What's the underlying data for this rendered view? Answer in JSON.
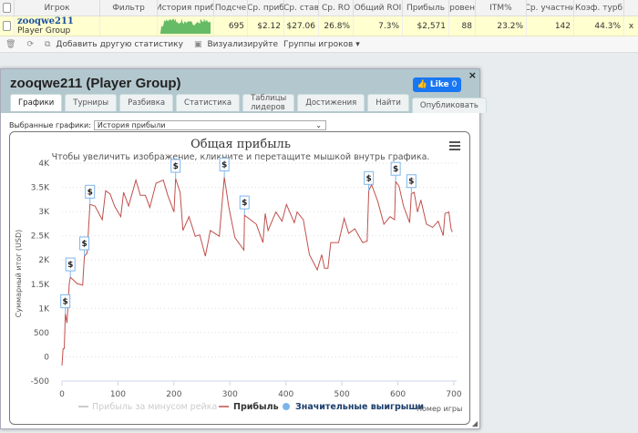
{
  "table": {
    "headers": [
      "Игрок",
      "Фильтр",
      "История приб",
      "Подсче",
      "Ср. приб",
      "Ср. став",
      "Ср. RO",
      "Общий ROI",
      "Прибыль",
      "Уровень",
      "ITM%",
      "Ср. участни",
      "Коэф. турб"
    ],
    "row": {
      "player": "zooqwe211",
      "group": "Player Group",
      "filter": "",
      "cells": [
        "695",
        "$2.12",
        "$27.06",
        "26.8%",
        "7.3%",
        "$2,571",
        "88",
        "23.2%",
        "142",
        "44.3%"
      ],
      "remove": "x"
    }
  },
  "toolbar": {
    "add_stat": "Добавить другую статистику",
    "visualize": "Визуализируйте",
    "player_groups": "Группы игроков"
  },
  "dialog": {
    "title": "zooqwe211 (Player Group)",
    "like_label": "Like",
    "like_count": "0",
    "close": "×",
    "tabs": [
      "Графики",
      "Турниры",
      "Разбивка",
      "Статистика",
      "Таблицы лидеров",
      "Достижения",
      "Найти",
      "Опубликовать"
    ],
    "selected_label": "Выбранные графики:",
    "selected_value": "История прибыли"
  },
  "colors": {
    "profit": "#c0504d",
    "big_win": "#7cb5ec",
    "sparkline": "#66bb66"
  },
  "chart_data": {
    "type": "line",
    "title": "Общая прибыль",
    "subtitle": "Чтобы увеличить изображение, кликните и перетащите мышкой внутрь графика.",
    "xlabel": "Номер игры",
    "ylabel": "Суммарный итог (USD)",
    "xlim": [
      0,
      700
    ],
    "ylim": [
      -500,
      4000
    ],
    "xticks": [
      "0",
      "100",
      "200",
      "300",
      "400",
      "500",
      "600",
      "700"
    ],
    "yticks": [
      "-500",
      "0",
      "500",
      "1K",
      "1.5K",
      "2K",
      "2.5K",
      "3K",
      "3.5K",
      "4K"
    ],
    "legend": [
      "Прибыль за минусом рейка",
      "Прибыль",
      "Значительные выигрыши"
    ],
    "series": [
      {
        "name": "Прибыль",
        "x": [
          0,
          2,
          4,
          6,
          9,
          13,
          15,
          27,
          37,
          40,
          45,
          50,
          59,
          72,
          78,
          86,
          94,
          105,
          110,
          119,
          132,
          140,
          149,
          157,
          168,
          181,
          189,
          200,
          203,
          211,
          216,
          227,
          238,
          246,
          256,
          265,
          281,
          290,
          298,
          309,
          325,
          326,
          347,
          359,
          363,
          368,
          382,
          393,
          401,
          415,
          420,
          431,
          442,
          456,
          464,
          469,
          475,
          480,
          494,
          504,
          512,
          523,
          537,
          545,
          548,
          553,
          564,
          575,
          586,
          594,
          596,
          602,
          610,
          621,
          624,
          629,
          635,
          641,
          651,
          662,
          672,
          681,
          684,
          691,
          695,
          697
        ],
        "y": [
          -180,
          164,
          170,
          887,
          700,
          1514,
          1645,
          1514,
          1480,
          2080,
          2140,
          3147,
          3115,
          2830,
          3430,
          3365,
          3115,
          2895,
          3400,
          3115,
          3650,
          3335,
          3335,
          3085,
          3585,
          3650,
          3335,
          2990,
          3680,
          3400,
          2610,
          2895,
          2490,
          2520,
          2080,
          2610,
          2490,
          3710,
          3085,
          2460,
          2205,
          2925,
          2740,
          2360,
          2960,
          2610,
          2990,
          2800,
          3147,
          2770,
          2990,
          2830,
          2110,
          1797,
          2110,
          1830,
          1830,
          2360,
          2360,
          2860,
          2550,
          2645,
          2360,
          2390,
          3430,
          3555,
          3210,
          2740,
          2895,
          2830,
          3620,
          3525,
          3115,
          2770,
          3365,
          3400,
          2990,
          3240,
          2740,
          2675,
          2800,
          2505,
          2960,
          2990,
          2645,
          2580
        ]
      }
    ],
    "big_wins": {
      "x": [
        6,
        15,
        40,
        50,
        203,
        290,
        326,
        548,
        596,
        624
      ],
      "y": [
        887,
        1645,
        2080,
        3147,
        3680,
        3710,
        2925,
        3430,
        3620,
        3365
      ],
      "label": "$"
    }
  }
}
